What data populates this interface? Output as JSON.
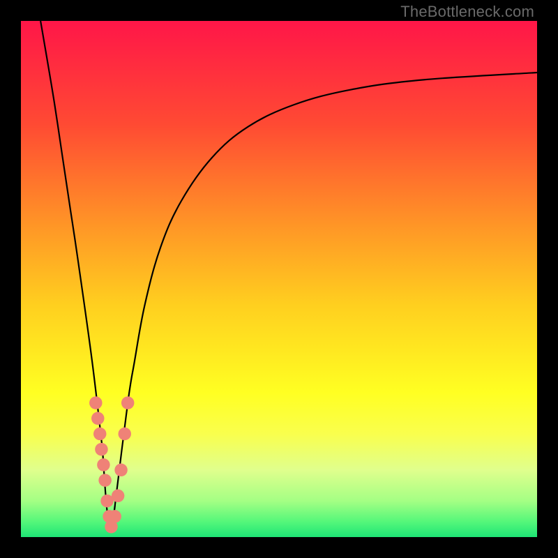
{
  "watermark": "TheBottleneck.com",
  "gradient": {
    "stops": [
      {
        "offset": 0.0,
        "color": "#ff1648"
      },
      {
        "offset": 0.2,
        "color": "#ff4a33"
      },
      {
        "offset": 0.4,
        "color": "#ff9726"
      },
      {
        "offset": 0.55,
        "color": "#ffcf1f"
      },
      {
        "offset": 0.72,
        "color": "#ffff22"
      },
      {
        "offset": 0.8,
        "color": "#f9ff4d"
      },
      {
        "offset": 0.87,
        "color": "#e0ff8d"
      },
      {
        "offset": 0.93,
        "color": "#a4ff84"
      },
      {
        "offset": 0.97,
        "color": "#55f77a"
      },
      {
        "offset": 1.0,
        "color": "#1ee576"
      }
    ]
  },
  "chart_data": {
    "type": "line",
    "title": "",
    "xlabel": "",
    "ylabel": "",
    "xlim": [
      0,
      100
    ],
    "ylim": [
      0,
      100
    ],
    "series": [
      {
        "name": "left-descent",
        "x": [
          3.8,
          5.0,
          6.5,
          8.0,
          9.5,
          11.0,
          13.8,
          15.8
        ],
        "y": [
          100,
          93,
          84,
          74,
          64,
          54,
          34,
          17
        ]
      },
      {
        "name": "v-bottom",
        "x": [
          15.8,
          16.6,
          17.4,
          18.2
        ],
        "y": [
          17,
          6,
          1,
          6
        ]
      },
      {
        "name": "right-rise",
        "x": [
          18.2,
          20.7,
          22.0,
          24.0,
          27.0,
          31.0,
          37.0,
          44.0,
          53.0,
          64.0,
          78.0,
          100.0
        ],
        "y": [
          6,
          26,
          34,
          45,
          56,
          65,
          73.5,
          79.5,
          83.8,
          86.7,
          88.6,
          90.0
        ]
      }
    ],
    "markers": {
      "name": "highlight-dots",
      "color": "#ef8277",
      "radius_pct": 1.25,
      "points": [
        {
          "x": 14.5,
          "y": 26
        },
        {
          "x": 14.9,
          "y": 23
        },
        {
          "x": 15.3,
          "y": 20
        },
        {
          "x": 15.6,
          "y": 17
        },
        {
          "x": 16.0,
          "y": 14
        },
        {
          "x": 16.3,
          "y": 11
        },
        {
          "x": 16.7,
          "y": 7
        },
        {
          "x": 17.1,
          "y": 4
        },
        {
          "x": 17.5,
          "y": 2
        },
        {
          "x": 18.2,
          "y": 4
        },
        {
          "x": 18.8,
          "y": 8
        },
        {
          "x": 19.4,
          "y": 13
        },
        {
          "x": 20.1,
          "y": 20
        },
        {
          "x": 20.7,
          "y": 26
        }
      ]
    }
  }
}
